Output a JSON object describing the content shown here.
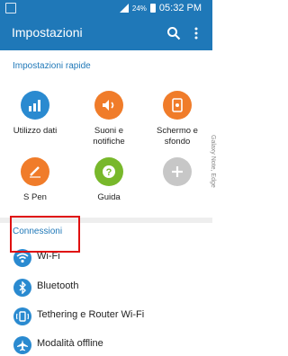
{
  "status_bar": {
    "battery_percent": "24%",
    "time": "05:32 PM"
  },
  "app_bar": {
    "title": "Impostazioni"
  },
  "quick_settings": {
    "title": "Impostazioni rapide",
    "items": [
      {
        "label": "Utilizzo dati",
        "icon": "bar-chart-icon",
        "color": "#2a8ad0"
      },
      {
        "label": "Suoni e\nnotifiche",
        "icon": "speaker-icon",
        "color": "#f07c2a"
      },
      {
        "label": "Schermo e\nsfondo",
        "icon": "screen-icon",
        "color": "#f07c2a"
      },
      {
        "label": "S Pen",
        "icon": "pen-icon",
        "color": "#f07c2a"
      },
      {
        "label": "Guida",
        "icon": "help-icon",
        "color": "#78b82b"
      },
      {
        "label": "",
        "icon": "add-icon",
        "color": "#c7c7c7"
      }
    ]
  },
  "connections": {
    "title": "Connessioni",
    "items": [
      {
        "label": "Wi-Fi",
        "icon": "wifi-icon"
      },
      {
        "label": "Bluetooth",
        "icon": "bluetooth-icon"
      },
      {
        "label": "Tethering e Router Wi-Fi",
        "icon": "tethering-icon"
      },
      {
        "label": "Modalità offline",
        "icon": "airplane-icon"
      }
    ]
  },
  "watermark": "Galaxy Note, Edge",
  "colors": {
    "accent": "#1f78b8",
    "highlight": "#e01010"
  }
}
